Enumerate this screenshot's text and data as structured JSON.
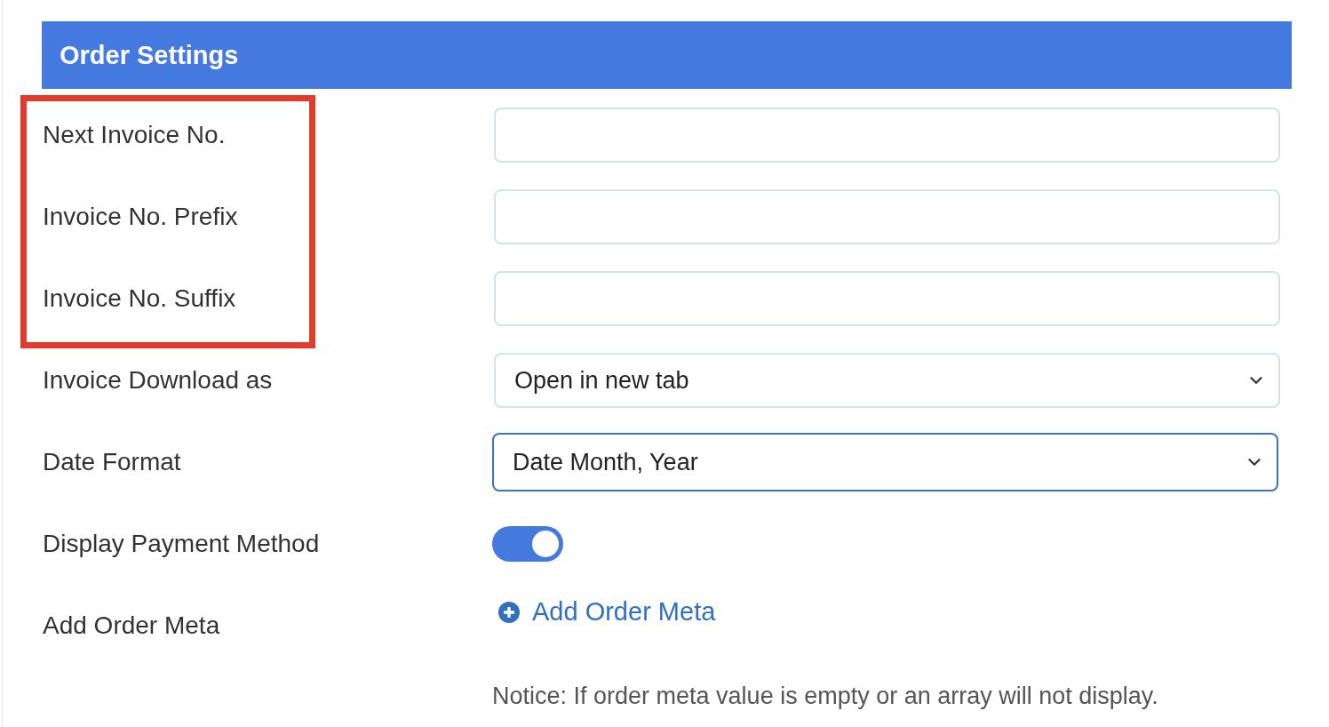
{
  "header": {
    "title": "Order Settings"
  },
  "fields": [
    {
      "kind": "text",
      "label": "Next Invoice No.",
      "highlighted": true,
      "focused": false
    },
    {
      "kind": "text",
      "label": "Invoice No. Prefix",
      "highlighted": true,
      "focused": false
    },
    {
      "kind": "text",
      "label": "Invoice No. Suffix",
      "highlighted": true,
      "focused": false
    },
    {
      "kind": "select",
      "label": "Invoice Download as",
      "value": "Open in new tab",
      "highlighted": false,
      "focused": false
    },
    {
      "kind": "select",
      "label": "Date Format",
      "value": "Date Month, Year",
      "highlighted": false,
      "focused": true
    },
    {
      "kind": "toggle",
      "label": "Display Payment Method",
      "on": true,
      "highlighted": false
    },
    {
      "kind": "link",
      "label": "Add Order Meta",
      "link": "Add Order Meta",
      "highlighted": false
    }
  ],
  "notice": "Notice: If order meta value is empty or an array will not display."
}
